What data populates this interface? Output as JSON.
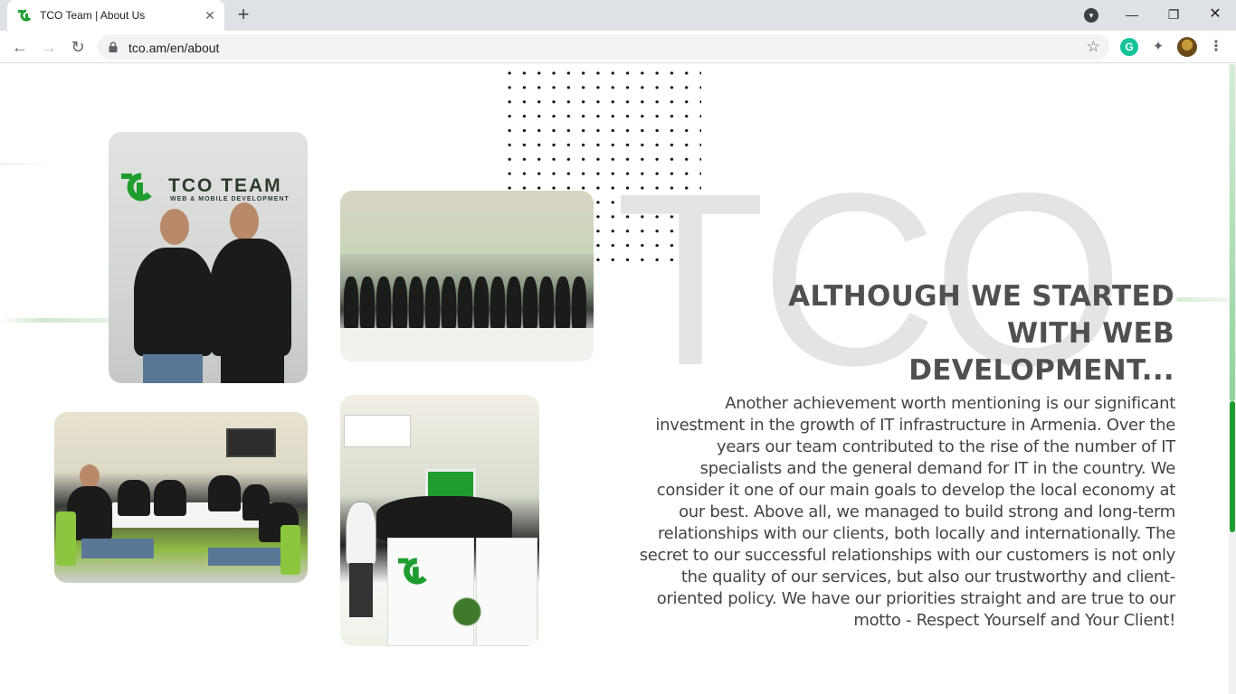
{
  "browser": {
    "tab_title": "TCO Team | About Us",
    "new_tab_label": "+",
    "url": "tco.am/en/about",
    "window_controls": [
      "minimize",
      "restore",
      "close"
    ],
    "extensions": [
      "grammarly-icon",
      "puzzle-icon",
      "profile-avatar"
    ],
    "grammarly_letter": "G"
  },
  "page": {
    "bg_watermark": "TCO",
    "heading": "ALTHOUGH WE STARTED WITH WEB DEVELOPMENT...",
    "body": "Another achievement worth mentioning is our significant investment in the growth of IT infrastructure in Armenia. Over the years our team contributed to the rise of the number of IT specialists and the general demand for IT in the country. We consider it one of our main goals to develop the local economy at our best. Above all, we managed to build strong and long-term relationships with our clients, both locally and internationally. The secret to our successful relationships with our customers is not only the quality of our services, but also our trustworthy and client-oriented policy. We have our priorities straight and are true to our motto - Respect Yourself and Your Client!",
    "photo1_logo_text": "TCO  TEAM",
    "photo1_logo_sub": "WEB & MOBILE DEVELOPMENT",
    "accent_color": "#1f9d2f"
  }
}
